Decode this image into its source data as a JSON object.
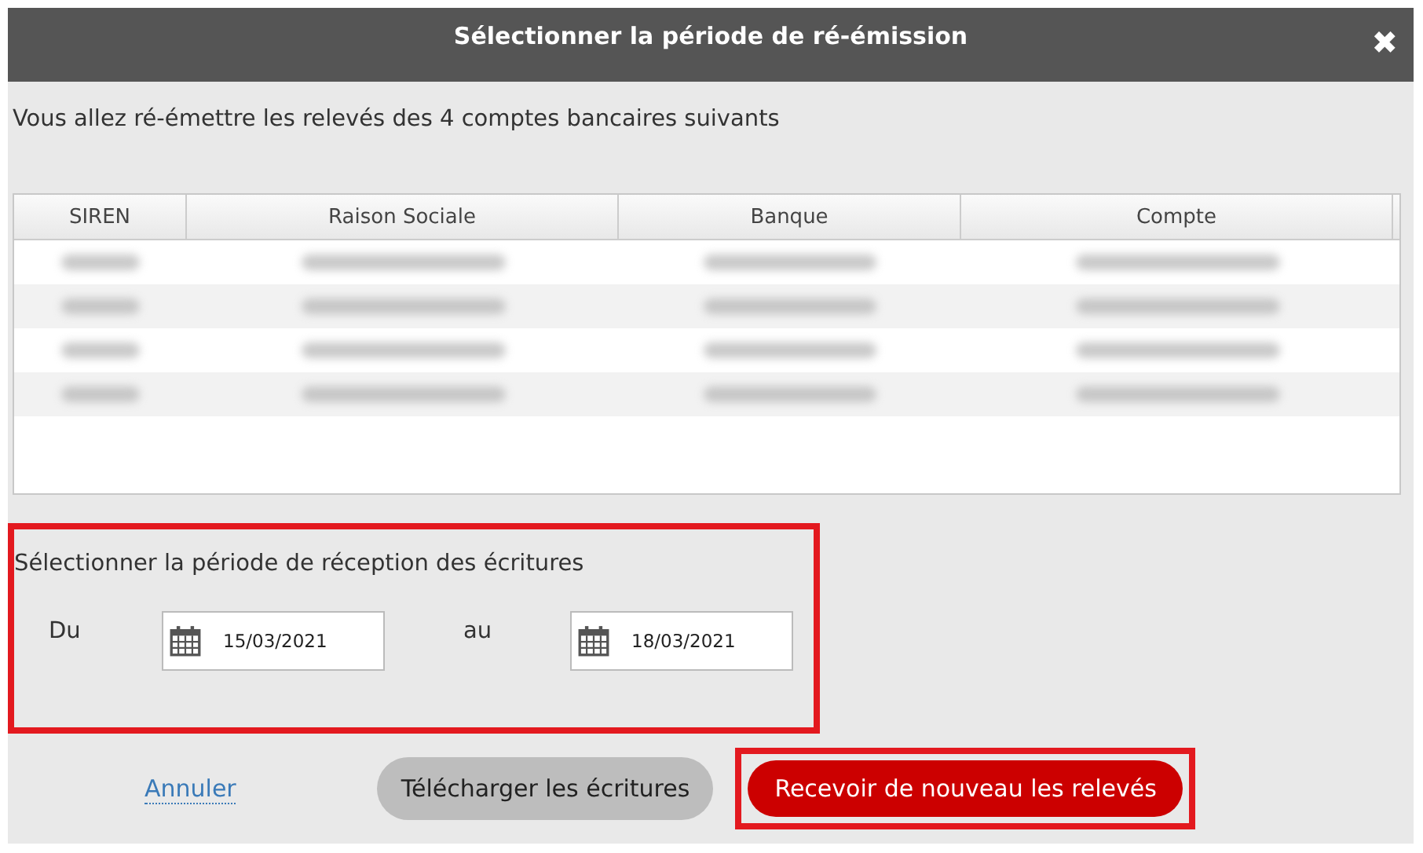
{
  "dialog": {
    "title": "Sélectionner la période de ré-émission",
    "close": "✖"
  },
  "intro": "Vous allez ré-émettre les relevés des 4 comptes bancaires suivants",
  "table": {
    "columns": [
      "SIREN",
      "Raison Sociale",
      "Banque",
      "Compte"
    ],
    "rows": [
      {
        "kind": "redacted"
      },
      {
        "kind": "redacted"
      },
      {
        "kind": "redacted"
      },
      {
        "kind": "redacted"
      }
    ]
  },
  "period": {
    "highlighted": true,
    "title": "Sélectionner la période de réception des écritures",
    "from_label": "Du",
    "from": "15/03/2021",
    "to_label": "au",
    "to": "18/03/2021"
  },
  "buttons": [
    {
      "kind": "link",
      "label": "Annuler",
      "highlighted": false
    },
    {
      "kind": "secondary",
      "label": "Télécharger les écritures",
      "highlighted": false
    },
    {
      "kind": "primary",
      "label": "Recevoir de nouveau les relevés",
      "highlighted": true
    }
  ]
}
